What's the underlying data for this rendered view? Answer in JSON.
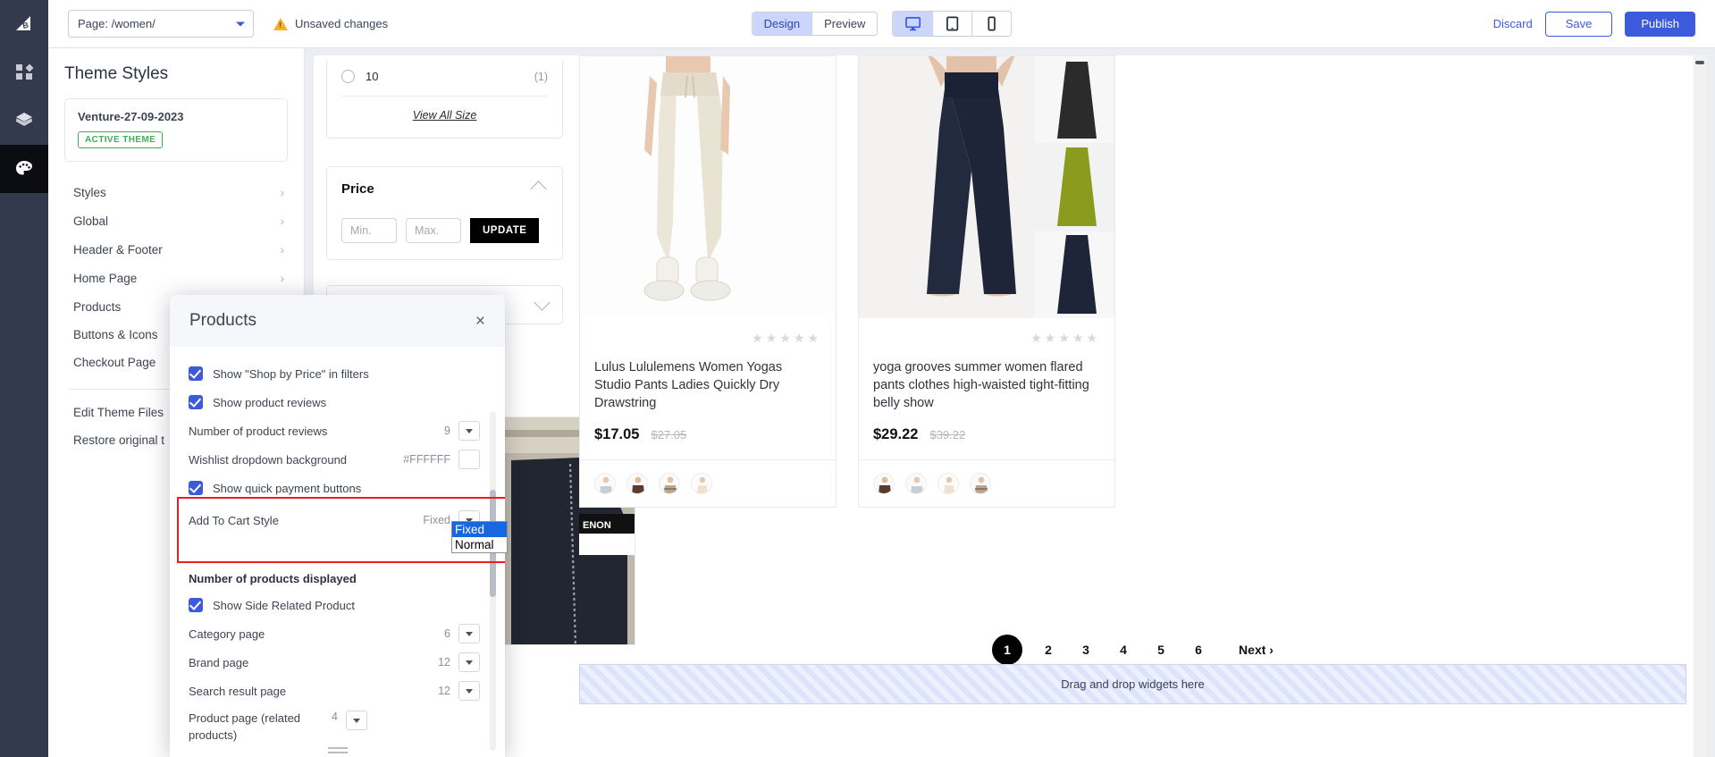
{
  "topbar": {
    "page_select_value": "Page: /women/",
    "unsaved_text": "Unsaved changes",
    "mode_design": "Design",
    "mode_preview": "Preview",
    "discard_label": "Discard",
    "save_label": "Save",
    "publish_label": "Publish",
    "devices": [
      "desktop",
      "tablet",
      "mobile"
    ]
  },
  "theme_panel": {
    "title": "Theme Styles",
    "theme_name": "Venture-27-09-2023",
    "active_badge": "ACTIVE THEME",
    "nav": [
      {
        "label": "Styles",
        "chevron": "›"
      },
      {
        "label": "Global",
        "chevron": "›"
      },
      {
        "label": "Header & Footer",
        "chevron": "›"
      },
      {
        "label": "Home Page",
        "chevron": "›"
      },
      {
        "label": "Products",
        "chevron": "›"
      },
      {
        "label": "Buttons & Icons",
        "chevron": ""
      },
      {
        "label": "Checkout Page",
        "chevron": ""
      }
    ],
    "footer_links": [
      "Edit Theme Files",
      "Restore original t"
    ]
  },
  "modal": {
    "title": "Products",
    "close": "×",
    "rows": [
      {
        "type": "checkbox",
        "label": "Show \"Shop by Price\" in filters",
        "checked": true
      },
      {
        "type": "checkbox",
        "label": "Show product reviews",
        "checked": true
      },
      {
        "type": "select",
        "label": "Number of product reviews",
        "value": "9"
      },
      {
        "type": "color",
        "label": "Wishlist dropdown background",
        "value": "#FFFFFF"
      },
      {
        "type": "checkbox",
        "label": "Show quick payment buttons",
        "checked": true
      },
      {
        "type": "select",
        "label": "Add To Cart Style",
        "value": "Fixed"
      }
    ],
    "section_title": "Number of products displayed",
    "rows2": [
      {
        "type": "checkbox",
        "label": "Show Side Related Product",
        "checked": true
      },
      {
        "type": "select",
        "label": "Category page",
        "value": "6"
      },
      {
        "type": "select",
        "label": "Brand page",
        "value": "12"
      },
      {
        "type": "select",
        "label": "Search result page",
        "value": "12"
      },
      {
        "type": "select",
        "label": "Product page (related products)",
        "value": "4"
      }
    ],
    "open_select_options": [
      {
        "label": "Fixed",
        "selected": true
      },
      {
        "label": "Normal",
        "selected": false
      }
    ],
    "highlight_color": "#e32121"
  },
  "preview": {
    "filters": {
      "size_option": {
        "label": "10",
        "count": "(1)"
      },
      "view_all": "View All Size",
      "price_title": "Price",
      "min_placeholder": "Min.",
      "max_placeholder": "Max.",
      "update_label": "UPDATE"
    },
    "products": [
      {
        "title": "Lulus Lululemens Women Yogas Studio Pants Ladies Quickly Dry Drawstring",
        "price": "$17.05",
        "old_price": "$27.05",
        "rating_stars": "★★★★★"
      },
      {
        "title": "yoga grooves summer women flared pants clothes high-waisted tight-fitting belly show",
        "price": "$29.22",
        "old_price": "$39.22",
        "rating_stars": "★★★★★"
      }
    ],
    "pagination": {
      "pages": [
        "1",
        "2",
        "3",
        "4",
        "5",
        "6"
      ],
      "current": "1",
      "next_label": "Next ›"
    },
    "dropzone_text": "Drag and drop widgets here"
  }
}
